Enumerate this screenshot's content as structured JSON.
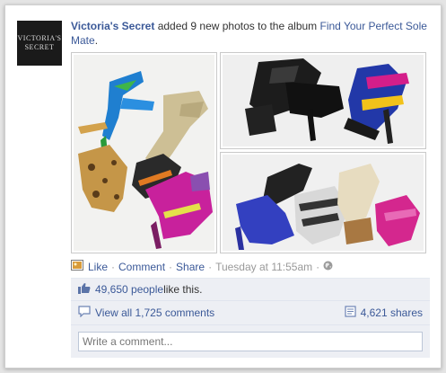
{
  "post": {
    "avatar_text_line1": "VICTORIA'S",
    "avatar_text_line2": "SECRET",
    "actor": "Victoria's Secret",
    "verb": " added 9 new photos to the album ",
    "album": "Find Your Perfect Sole Mate",
    "period": "."
  },
  "actions": {
    "like": "Like",
    "comment": "Comment",
    "share": "Share",
    "timestamp": "Tuesday at 11:55am",
    "sep": "·"
  },
  "ufi": {
    "likes_count": "49,650 people",
    "likes_suffix": " like this.",
    "view_comments": "View all 1,725 comments",
    "shares": "4,621 shares",
    "comment_placeholder": "Write a comment..."
  },
  "colors": {
    "link": "#3b5998",
    "ufi_bg": "#edeff4",
    "meta": "#999999"
  },
  "icons": [
    "photo-icon",
    "thumbs-up-icon",
    "comment-bubble-icon",
    "share-icon",
    "globe-icon"
  ]
}
